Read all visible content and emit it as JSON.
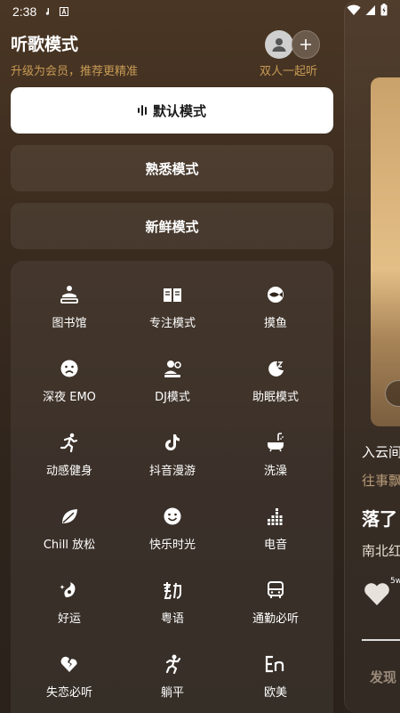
{
  "status_bar": {
    "time": "2:38"
  },
  "header": {
    "title": "听歌模式",
    "subtitle": "升级为会员，推荐更精准",
    "duo_label": "双人一起听"
  },
  "modes": [
    {
      "label": "默认模式",
      "active": true
    },
    {
      "label": "熟悉模式",
      "active": false
    },
    {
      "label": "新鲜模式",
      "active": false
    }
  ],
  "scenes": [
    {
      "label": "图书馆",
      "icon": "library-icon"
    },
    {
      "label": "专注模式",
      "icon": "book-icon"
    },
    {
      "label": "摸鱼",
      "icon": "fish-icon"
    },
    {
      "label": "深夜 EMO",
      "icon": "sad-face-icon"
    },
    {
      "label": "DJ模式",
      "icon": "dj-icon"
    },
    {
      "label": "助眠模式",
      "icon": "moon-sleep-icon"
    },
    {
      "label": "动感健身",
      "icon": "running-icon"
    },
    {
      "label": "抖音漫游",
      "icon": "tiktok-icon"
    },
    {
      "label": "洗澡",
      "icon": "bathtub-icon"
    },
    {
      "label": "Chill 放松",
      "icon": "leaf-icon"
    },
    {
      "label": "快乐时光",
      "icon": "smile-icon"
    },
    {
      "label": "电音",
      "icon": "equalizer-icon"
    },
    {
      "label": "好运",
      "icon": "lucky-icon"
    },
    {
      "label": "粤语",
      "icon": "cantonese-icon"
    },
    {
      "label": "通勤必听",
      "icon": "bus-icon"
    },
    {
      "label": "失恋必听",
      "icon": "broken-heart-icon"
    },
    {
      "label": "躺平",
      "icon": "lying-flat-icon"
    },
    {
      "label": "欧美",
      "icon": "english-icon"
    }
  ],
  "preview": {
    "line1": "入云间",
    "line2": "往事飘",
    "song_title": "落了",
    "artist": "南北红",
    "like_count": "5w",
    "tab_label": "发现"
  }
}
